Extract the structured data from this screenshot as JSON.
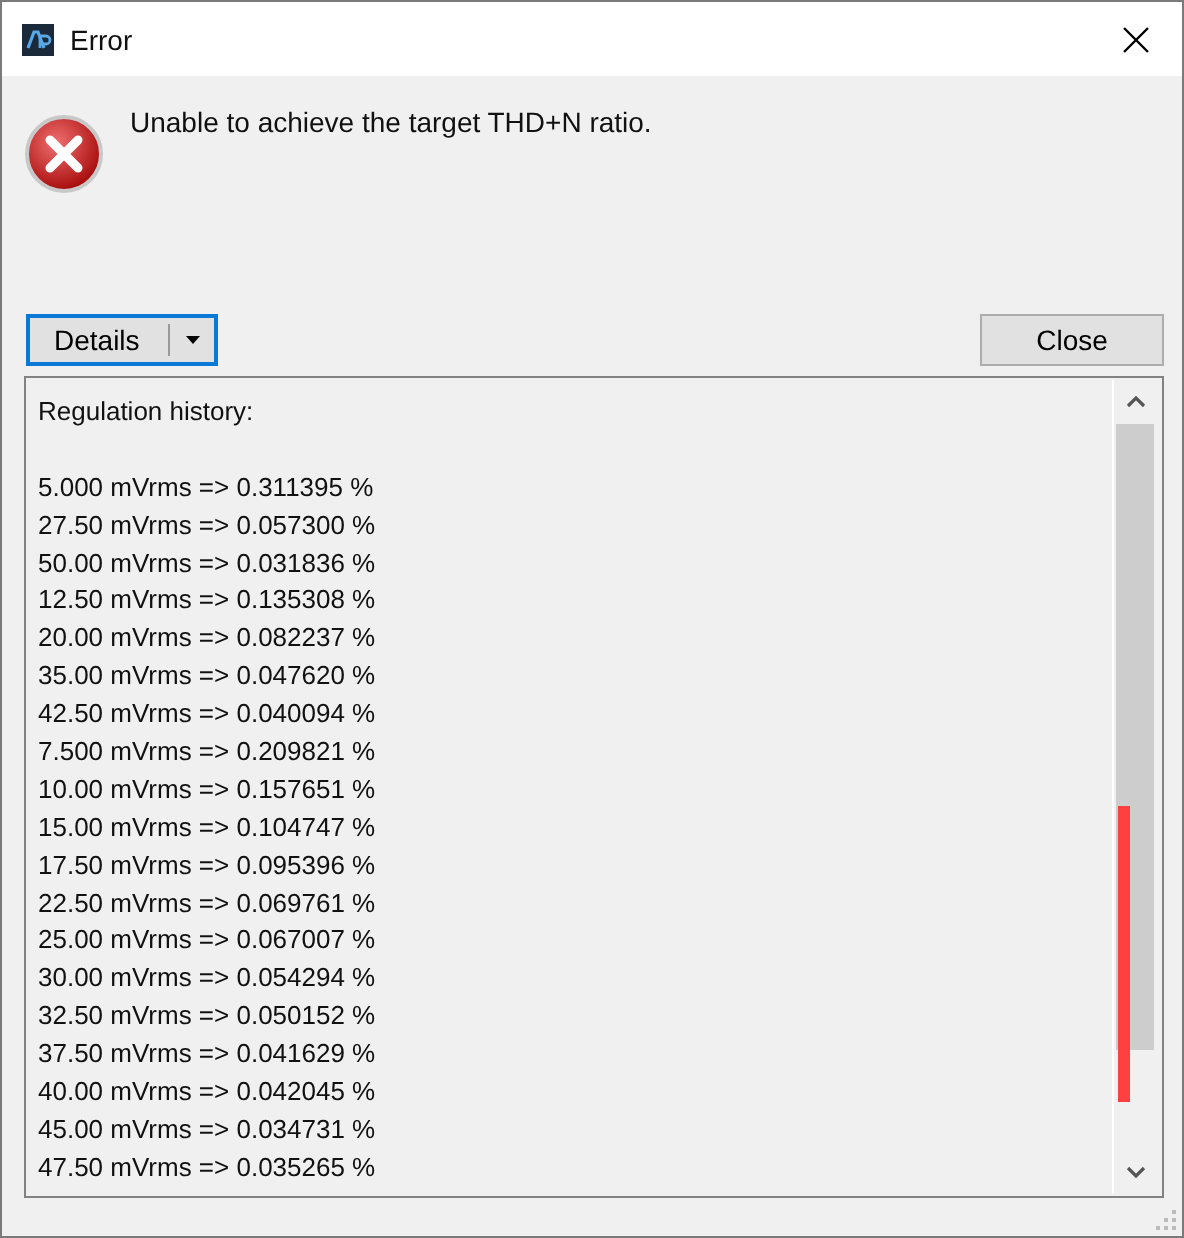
{
  "window": {
    "title": "Error"
  },
  "message": "Unable to achieve the target THD+N ratio.",
  "buttons": {
    "details": "Details",
    "close": "Close"
  },
  "details": {
    "heading": "Regulation history:",
    "lines": [
      "5.000 mVrms => 0.311395 %",
      "27.50 mVrms => 0.057300 %",
      "50.00 mVrms => 0.031836 %",
      "12.50 mVrms => 0.135308 %",
      "20.00 mVrms => 0.082237 %",
      "35.00 mVrms => 0.047620 %",
      "42.50 mVrms => 0.040094 %",
      "7.500 mVrms => 0.209821 %",
      "10.00 mVrms => 0.157651 %",
      "15.00 mVrms => 0.104747 %",
      "17.50 mVrms => 0.095396 %",
      "22.50 mVrms => 0.069761 %",
      "25.00 mVrms => 0.067007 %",
      "30.00 mVrms => 0.054294 %",
      "32.50 mVrms => 0.050152 %",
      "37.50 mVrms => 0.041629 %",
      "40.00 mVrms => 0.042045 %",
      "45.00 mVrms => 0.034731 %",
      "47.50 mVrms => 0.035265 %"
    ]
  }
}
